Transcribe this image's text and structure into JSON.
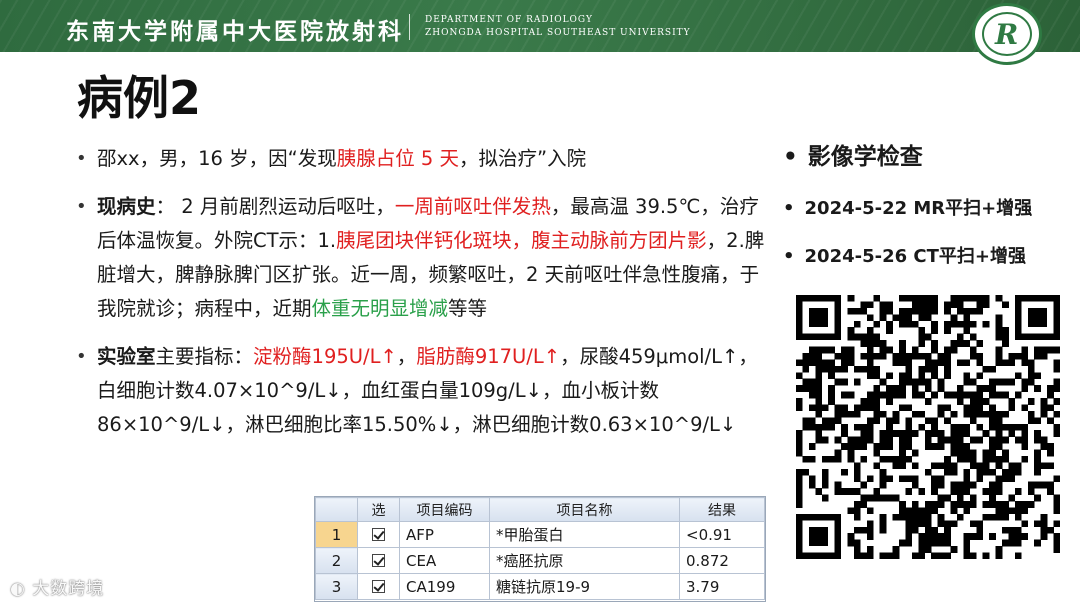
{
  "header": {
    "hospital_cn": "东南大学附属中大医院放射科",
    "dept_en": "DEPARTMENT OF RADIOLOGY",
    "hospital_en": "ZHONGDA HOSPITAL SOUTHEAST UNIVERSITY",
    "logo_mark": "R",
    "brand_color": "#2f6b3f"
  },
  "title": "病例2",
  "bullets": {
    "b1": {
      "t1": "邵xx，男，16 岁，因“发现",
      "t2": "胰腺占位 5 天",
      "t3": "，拟治疗”入院"
    },
    "b2": {
      "label": "现病史",
      "t1": "： 2 月前剧烈运动后呕吐，",
      "t2": "一周前呕吐伴发热",
      "t3": "，最高温 39.5℃，治疗后体温恢复。外院CT示：1.",
      "t4": "胰尾团块伴钙化斑块，腹主动脉前方团片影",
      "t5": "，2.脾脏增大，脾静脉脾门区扩张。近一周，频繁呕吐，2 天前呕吐伴急性腹痛，于我院就诊；病程中，近期",
      "t6": "体重无明显增减",
      "t7": "等等"
    },
    "b3": {
      "label": "实验室",
      "t1": "主要指标：",
      "t2": "淀粉酶195U/L↑",
      "t3": "，",
      "t4": "脂肪酶917U/L↑",
      "t5": "，尿酸459μmol/L↑，白细胞计数4.07×10^9/L↓，血红蛋白量109g/L↓，血小板计数86×10^9/L↓，淋巴细胞比率15.50%↓，淋巴细胞计数0.63×10^9/L↓"
    }
  },
  "right_panel": {
    "heading": "影像学检查",
    "items": [
      "2024-5-22 MR平扫+增强",
      "2024-5-26 CT平扫+增强"
    ]
  },
  "lab_table": {
    "headers": [
      "",
      "选",
      "项目编码",
      "项目名称",
      "结果"
    ],
    "rows": [
      {
        "n": "1",
        "code": "AFP",
        "name": "*甲胎蛋白",
        "result": "<0.91"
      },
      {
        "n": "2",
        "code": "CEA",
        "name": "*癌胚抗原",
        "result": "0.872"
      },
      {
        "n": "3",
        "code": "CA199",
        "name": "糖链抗原19-9",
        "result": "3.79"
      }
    ]
  },
  "watermark": "大数跨境",
  "colors": {
    "highlight_red": "#e02020",
    "highlight_green": "#2aa04a"
  }
}
